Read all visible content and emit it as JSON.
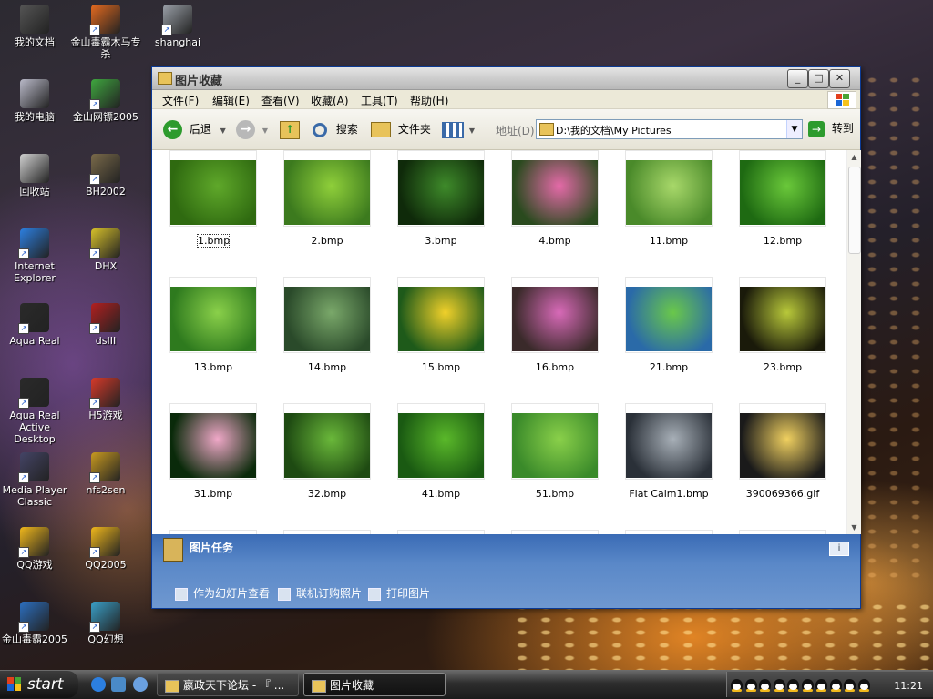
{
  "desktop": {
    "icons": [
      {
        "label": "我的文档",
        "x": 0,
        "y": 0,
        "color": "#555555"
      },
      {
        "label": "金山毒霸木马专杀",
        "x": 0,
        "y": 0,
        "color": "#e46a1f"
      },
      {
        "label": "shanghai",
        "x": 0,
        "y": 0,
        "color": "#9aa0a8"
      },
      {
        "label": "我的电脑",
        "x": 0,
        "y": 0,
        "color": "#b9b9c8"
      },
      {
        "label": "金山网镖2005",
        "x": 0,
        "y": 0,
        "color": "#3fa63f"
      },
      {
        "label": "回收站",
        "x": 0,
        "y": 0,
        "color": "#d0d0d0"
      },
      {
        "label": "BH2002",
        "x": 0,
        "y": 0,
        "color": "#7a6a4a"
      },
      {
        "label": "Internet Explorer",
        "x": 0,
        "y": 0,
        "color": "#2c7fe0"
      },
      {
        "label": "DHX",
        "x": 0,
        "y": 0,
        "color": "#d6c02a"
      },
      {
        "label": "Aqua Real",
        "x": 0,
        "y": 0,
        "color": "#2a2a2a"
      },
      {
        "label": "dsIII",
        "x": 0,
        "y": 0,
        "color": "#b32020"
      },
      {
        "label": "Aqua Real Active Desktop",
        "x": 0,
        "y": 0,
        "color": "#2a2a2a"
      },
      {
        "label": "H5游戏",
        "x": 0,
        "y": 0,
        "color": "#d83a2a"
      },
      {
        "label": "Media Player Classic",
        "x": 0,
        "y": 0,
        "color": "#444466"
      },
      {
        "label": "nfs2sen",
        "x": 0,
        "y": 0,
        "color": "#c89a20"
      },
      {
        "label": "QQ游戏",
        "x": 0,
        "y": 0,
        "color": "#f0b81c"
      },
      {
        "label": "QQ2005",
        "x": 0,
        "y": 0,
        "color": "#f0b81c"
      },
      {
        "label": "金山毒霸2005",
        "x": 0,
        "y": 0,
        "color": "#2c6fc0"
      },
      {
        "label": "QQ幻想",
        "x": 0,
        "y": 0,
        "color": "#3aa0c8"
      }
    ]
  },
  "window": {
    "title": "图片收藏",
    "buttons": {
      "minimize": "_",
      "maximize": "□",
      "close": "✕"
    },
    "menu": [
      "文件(F)",
      "编辑(E)",
      "查看(V)",
      "收藏(A)",
      "工具(T)",
      "帮助(H)"
    ],
    "toolbar": {
      "back": "后退",
      "search": "搜索",
      "folders": "文件夹",
      "address_label": "地址(D)",
      "address_value": "D:\\我的文档\\My Pictures",
      "go": "转到"
    },
    "thumbnails": [
      {
        "name": "1.bmp",
        "c1": "#5fa82a",
        "c2": "#2f6a10"
      },
      {
        "name": "2.bmp",
        "c1": "#8fcf3a",
        "c2": "#3c7a1e"
      },
      {
        "name": "3.bmp",
        "c1": "#3e8a2a",
        "c2": "#0f2a0a"
      },
      {
        "name": "4.bmp",
        "c1": "#e46aa8",
        "c2": "#2a4a1e"
      },
      {
        "name": "11.bmp",
        "c1": "#a8d86a",
        "c2": "#4a8a2a"
      },
      {
        "name": "12.bmp",
        "c1": "#6ac83a",
        "c2": "#1e6a12"
      },
      {
        "name": "13.bmp",
        "c1": "#8ad04a",
        "c2": "#2e7a1e"
      },
      {
        "name": "14.bmp",
        "c1": "#7aa86a",
        "c2": "#2a4a2a"
      },
      {
        "name": "15.bmp",
        "c1": "#f0d02a",
        "c2": "#1e5a1a"
      },
      {
        "name": "16.bmp",
        "c1": "#d86ab8",
        "c2": "#3a2a2a"
      },
      {
        "name": "21.bmp",
        "c1": "#6ac84a",
        "c2": "#2a6aa8"
      },
      {
        "name": "23.bmp",
        "c1": "#b8c83a",
        "c2": "#1a1a0a"
      },
      {
        "name": "31.bmp",
        "c1": "#f0a8c8",
        "c2": "#0a2a0a"
      },
      {
        "name": "32.bmp",
        "c1": "#6ab83a",
        "c2": "#1e4a12"
      },
      {
        "name": "41.bmp",
        "c1": "#5ab82a",
        "c2": "#1a5a12"
      },
      {
        "name": "51.bmp",
        "c1": "#8ad04a",
        "c2": "#3a8a2a"
      },
      {
        "name": "Flat Calm1.bmp",
        "c1": "#a8b0b8",
        "c2": "#2a3038"
      },
      {
        "name": "390069366.gif",
        "c1": "#f0d060",
        "c2": "#1a1a1a"
      }
    ],
    "tasks_panel": {
      "title": "图片任务",
      "items": [
        "作为幻灯片查看",
        "联机订购照片",
        "打印图片"
      ]
    }
  },
  "taskbar": {
    "start": "start",
    "items": [
      "嬴政天下论坛 - 『 ...",
      "图片收藏"
    ],
    "clock": "11:21"
  }
}
